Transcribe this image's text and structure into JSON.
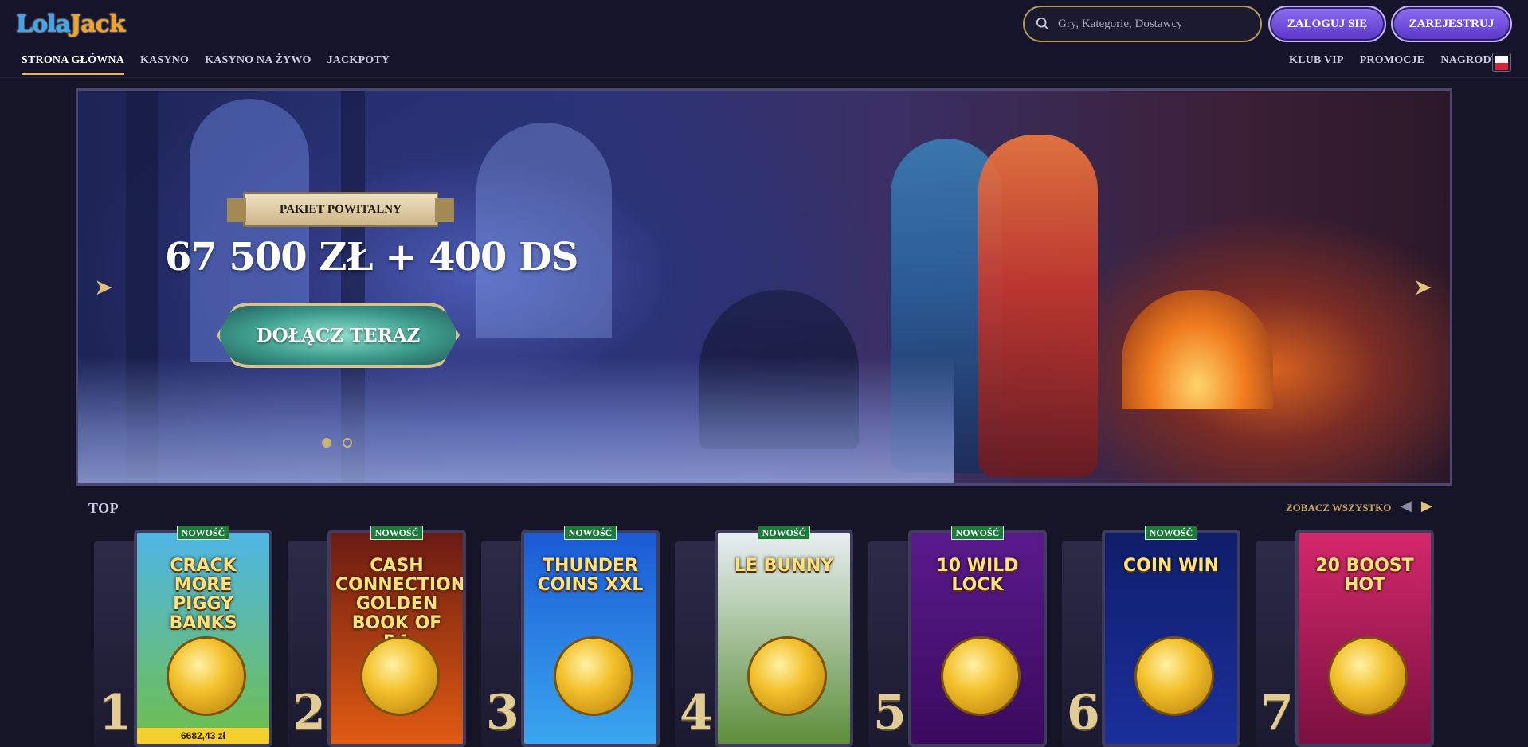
{
  "header": {
    "logo_part1": "Lola",
    "logo_part2": "Jack",
    "search_placeholder": "Gry, Kategorie, Dostawcy",
    "login_label": "ZALOGUJ SIĘ",
    "register_label": "ZAREJESTRUJ",
    "nav_left": [
      "STRONA GŁÓWNA",
      "KASYNO",
      "KASYNO NA ŻYWO",
      "JACKPOTY"
    ],
    "nav_right": [
      "KLUB VIP",
      "PROMOCJE",
      "NAGRODY"
    ]
  },
  "banner": {
    "ribbon": "PAKIET POWITALNY",
    "headline": "67 500 ZŁ + 400 DS",
    "cta": "DOŁĄCZ TERAZ",
    "active_slide": 1,
    "slide_count": 2
  },
  "top": {
    "title": "TOP",
    "see_all": "ZOBACZ WSZYSTKO",
    "games": [
      {
        "rank": "1",
        "badge": "NOWOŚĆ",
        "name": "CRACK MORE PIGGY BANKS",
        "jackpot": "6682,43 zł",
        "color_top": "#4fb6e6",
        "color_bottom": "#6fbf4a"
      },
      {
        "rank": "2",
        "badge": "NOWOŚĆ",
        "name": "CASH CONNECTION GOLDEN BOOK OF RA",
        "jackpot": "",
        "color_top": "#6a1b12",
        "color_bottom": "#e25b12"
      },
      {
        "rank": "3",
        "badge": "NOWOŚĆ",
        "name": "THUNDER COINS XXL",
        "jackpot": "",
        "color_top": "#1b5ad4",
        "color_bottom": "#3aa6f0"
      },
      {
        "rank": "4",
        "badge": "NOWOŚĆ",
        "name": "LE BUNNY",
        "jackpot": "",
        "color_top": "#e8eef2",
        "color_bottom": "#5d8f3a"
      },
      {
        "rank": "5",
        "badge": "NOWOŚĆ",
        "name": "10 WILD LOCK",
        "jackpot": "",
        "color_top": "#5a1a8c",
        "color_bottom": "#3a0a5e"
      },
      {
        "rank": "6",
        "badge": "NOWOŚĆ",
        "name": "COIN WIN",
        "jackpot": "",
        "color_top": "#0f1e6a",
        "color_bottom": "#1b2f9c"
      },
      {
        "rank": "7",
        "badge": "",
        "name": "20 BOOST HOT",
        "jackpot": "",
        "color_top": "#d4286c",
        "color_bottom": "#7a1040"
      }
    ]
  }
}
